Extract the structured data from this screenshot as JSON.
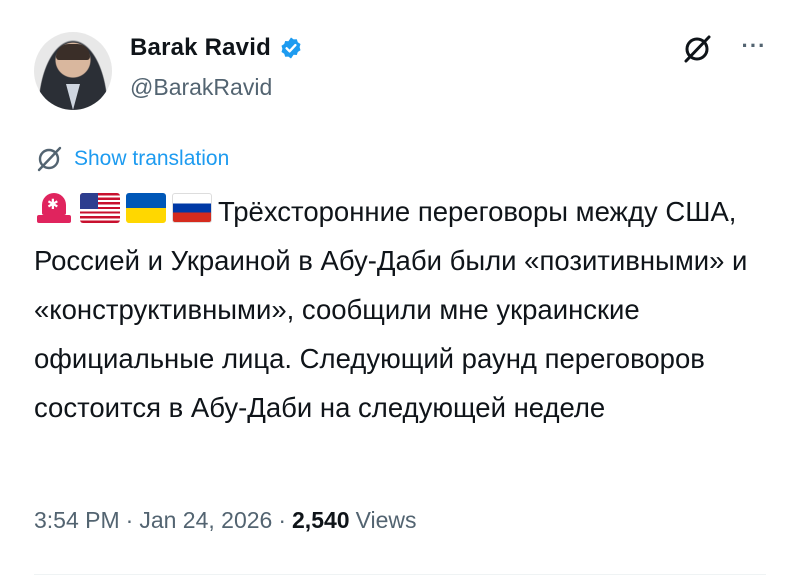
{
  "author": {
    "display_name": "Barak Ravid",
    "handle": "@BarakRavid",
    "verified": true
  },
  "actions": {
    "grok_icon": "grok-slash-icon",
    "more_label": "···"
  },
  "translation": {
    "label": "Show translation",
    "icon": "grok-slash-icon"
  },
  "tweet": {
    "emojis": [
      "siren",
      "flag-us",
      "flag-ua",
      "flag-ru"
    ],
    "text": "Трёхсторонние переговоры между США, Россией и Украиной в Абу-Даби были «позитивными» и «конструктивными», сообщили мне украинские официальные лица. Следующий раунд переговоров состоится в Абу-Даби на следующей неделе"
  },
  "meta": {
    "time": "3:54 PM",
    "separator": "·",
    "date": "Jan 24, 2026",
    "views_count": "2,540",
    "views_label": "Views"
  },
  "colors": {
    "accent": "#1d9bf0",
    "secondary_text": "#536471",
    "primary_text": "#0f1419"
  }
}
